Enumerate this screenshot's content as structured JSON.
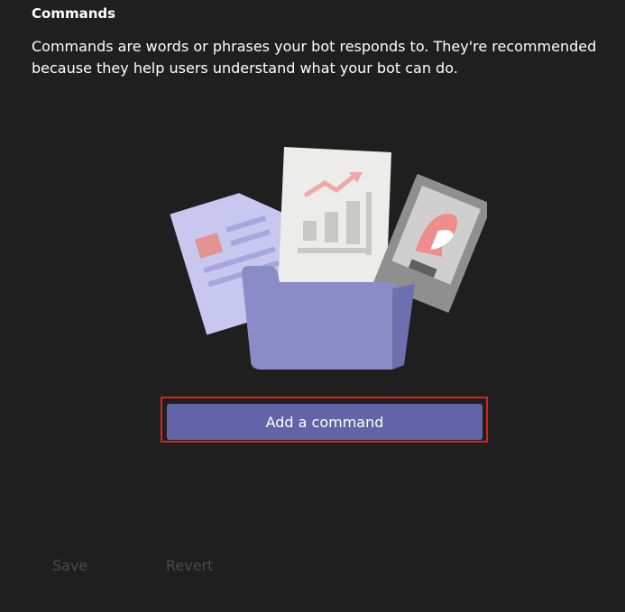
{
  "section": {
    "title": "Commands",
    "description": "Commands are words or phrases your bot responds to. They're recommended because they help users understand what your bot can do."
  },
  "illustration": {
    "icon": "documents-folder-illustration"
  },
  "actions": {
    "add_command_label": "Add a command",
    "save_label": "Save",
    "revert_label": "Revert"
  },
  "colors": {
    "background": "#1f1f1f",
    "accent": "#6264a7",
    "highlight": "#e01e1e",
    "disabled_text": "#4a4a4a"
  }
}
